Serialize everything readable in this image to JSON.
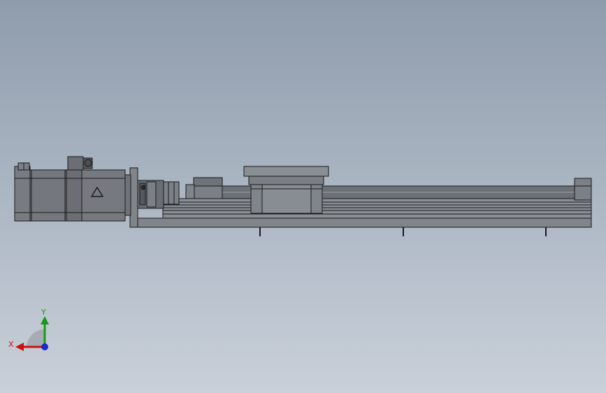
{
  "viewport": {
    "background_top": "#8e9cac",
    "background_bottom": "#c9d0d9",
    "model_line_color": "#1a1a1a",
    "model_fill_color": "#7b7f86"
  },
  "model": {
    "type": "linear-actuator-side-view",
    "components": [
      "servo-motor",
      "motor-flange-plate",
      "coupling",
      "ball-screw",
      "carriage-table",
      "linear-rail-base",
      "end-block"
    ]
  },
  "triad": {
    "x_label": "X",
    "y_label": "Y",
    "x_color": "#cc1111",
    "y_color": "#1a9a1a",
    "z_color": "#1a2acc"
  }
}
